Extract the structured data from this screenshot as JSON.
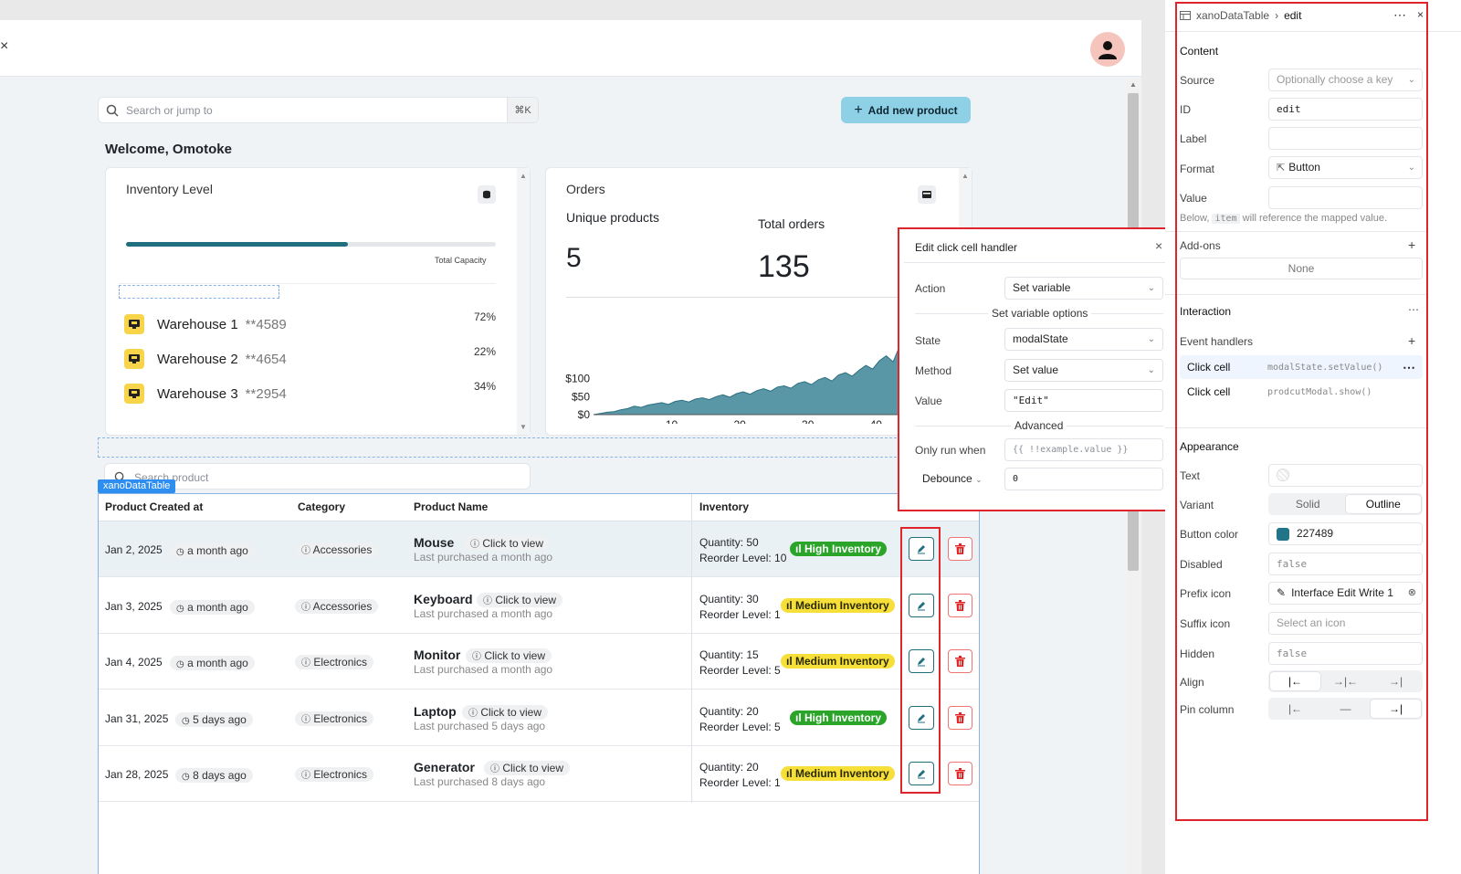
{
  "app": {
    "close_glyph": "×",
    "search": {
      "placeholder": "Search or jump to",
      "shortcut": "⌘K"
    },
    "add_button": "Add new product",
    "welcome": "Welcome, Omotoke",
    "inventory_card": {
      "title": "Inventory Level",
      "capacity_label": "Total Capacity",
      "capacity_fill_percent": 60,
      "warehouses": [
        {
          "name": "Warehouse 1",
          "number": "**4589",
          "percent": "72%"
        },
        {
          "name": "Warehouse 2",
          "number": "**4654",
          "percent": "22%"
        },
        {
          "name": "Warehouse 3",
          "number": "**2954",
          "percent": "34%"
        }
      ]
    },
    "orders_card": {
      "title": "Orders",
      "unique_label": "Unique products",
      "unique_value": "5",
      "total_label": "Total orders",
      "total_value": "135"
    },
    "product_search_placeholder": "Search product",
    "table_tag": "xanoDataTable",
    "table": {
      "headers": [
        "Product Created at",
        "Category",
        "Product Name",
        "Inventory"
      ],
      "click_to_view": "Click to view",
      "rows": [
        {
          "date": "Jan 2, 2025",
          "ago": "a month ago",
          "category": "Accessories",
          "name": "Mouse",
          "sub": "Last purchased a month ago",
          "quantity": "Quantity: 50",
          "reorder": "Reorder Level: 10",
          "badge": "High Inventory",
          "level": "high"
        },
        {
          "date": "Jan 3, 2025",
          "ago": "a month ago",
          "category": "Accessories",
          "name": "Keyboard",
          "sub": "Last purchased a month ago",
          "quantity": "Quantity: 30",
          "reorder": "Reorder Level: 1",
          "badge": "Medium Inventory",
          "level": "med"
        },
        {
          "date": "Jan 4, 2025",
          "ago": "a month ago",
          "category": "Electronics",
          "name": "Monitor",
          "sub": "Last purchased a month ago",
          "quantity": "Quantity: 15",
          "reorder": "Reorder Level: 5",
          "badge": "Medium Inventory",
          "level": "med"
        },
        {
          "date": "Jan 31, 2025",
          "ago": "5 days ago",
          "category": "Electronics",
          "name": "Laptop",
          "sub": "Last purchased 5 days ago",
          "quantity": "Quantity: 20",
          "reorder": "Reorder Level: 5",
          "badge": "High Inventory",
          "level": "high"
        },
        {
          "date": "Jan 28, 2025",
          "ago": "8 days ago",
          "category": "Electronics",
          "name": "Generator",
          "sub": "Last purchased 8 days ago",
          "quantity": "Quantity: 20",
          "reorder": "Reorder Level: 1",
          "badge": "Medium Inventory",
          "level": "med"
        }
      ]
    }
  },
  "chart_data": {
    "type": "area",
    "x_ticks": [
      10,
      20,
      30,
      40
    ],
    "y_ticks": [
      "$0",
      "$50",
      "$100"
    ],
    "xlim": [
      0,
      46
    ],
    "ylim": [
      0,
      140
    ],
    "x": [
      0,
      1,
      2,
      3,
      4,
      5,
      6,
      7,
      8,
      9,
      10,
      11,
      12,
      13,
      14,
      15,
      16,
      17,
      18,
      19,
      20,
      21,
      22,
      23,
      24,
      25,
      26,
      27,
      28,
      29,
      30,
      31,
      32,
      33,
      34,
      35,
      36,
      37,
      38,
      39,
      40,
      41,
      42,
      43,
      44,
      45,
      46
    ],
    "values": [
      0,
      2,
      4,
      5,
      8,
      10,
      14,
      12,
      16,
      18,
      20,
      17,
      22,
      24,
      21,
      26,
      28,
      25,
      30,
      33,
      29,
      35,
      38,
      34,
      40,
      43,
      39,
      46,
      48,
      44,
      52,
      55,
      50,
      58,
      62,
      56,
      66,
      70,
      64,
      74,
      82,
      76,
      90,
      98,
      88,
      115,
      128
    ],
    "color": "#5a97a6"
  },
  "popup": {
    "title": "Edit click cell handler",
    "close_glyph": "×",
    "action_label": "Action",
    "action_value": "Set variable",
    "options_heading": "Set variable options",
    "state_label": "State",
    "state_value": "modalState",
    "method_label": "Method",
    "method_value": "Set value",
    "value_label": "Value",
    "value_value": "\"Edit\"",
    "advanced_heading": "Advanced",
    "only_run_label": "Only run when",
    "only_run_placeholder": "{{ !!example.value }}",
    "debounce_label": "Debounce",
    "debounce_value": "0"
  },
  "panel": {
    "breadcrumb_component": "xanoDataTable",
    "breadcrumb_sep": "›",
    "breadcrumb_current": "edit",
    "more_glyph": "⋯",
    "close_glyph": "×",
    "content_heading": "Content",
    "source_label": "Source",
    "source_placeholder": "Optionally choose a key",
    "id_label": "ID",
    "id_value": "edit",
    "label_label": "Label",
    "label_value": "",
    "format_label": "Format",
    "format_value": "Button",
    "value_label": "Value",
    "value_value": "",
    "hint_pre": "Below,",
    "hint_code": "item",
    "hint_post": "will reference the mapped value.",
    "addons_heading": "Add-ons",
    "addons_none": "None",
    "interaction_heading": "Interaction",
    "event_handlers_label": "Event handlers",
    "handlers": [
      {
        "label": "Click cell",
        "code": "modalState.setValue()"
      },
      {
        "label": "Click cell",
        "code": "prodcutModal.show()"
      }
    ],
    "appearance_heading": "Appearance",
    "text_label": "Text",
    "variant_label": "Variant",
    "variant_options": [
      "Solid",
      "Outline"
    ],
    "variant_selected": "Outline",
    "button_color_label": "Button color",
    "button_color_value": "227489",
    "button_color_hex": "#227489",
    "disabled_label": "Disabled",
    "disabled_value": "false",
    "prefix_icon_label": "Prefix icon",
    "prefix_icon_value": "Interface Edit Write 1",
    "suffix_icon_label": "Suffix icon",
    "suffix_icon_placeholder": "Select an icon",
    "hidden_label": "Hidden",
    "hidden_value": "false",
    "align_label": "Align",
    "pin_column_label": "Pin column"
  }
}
